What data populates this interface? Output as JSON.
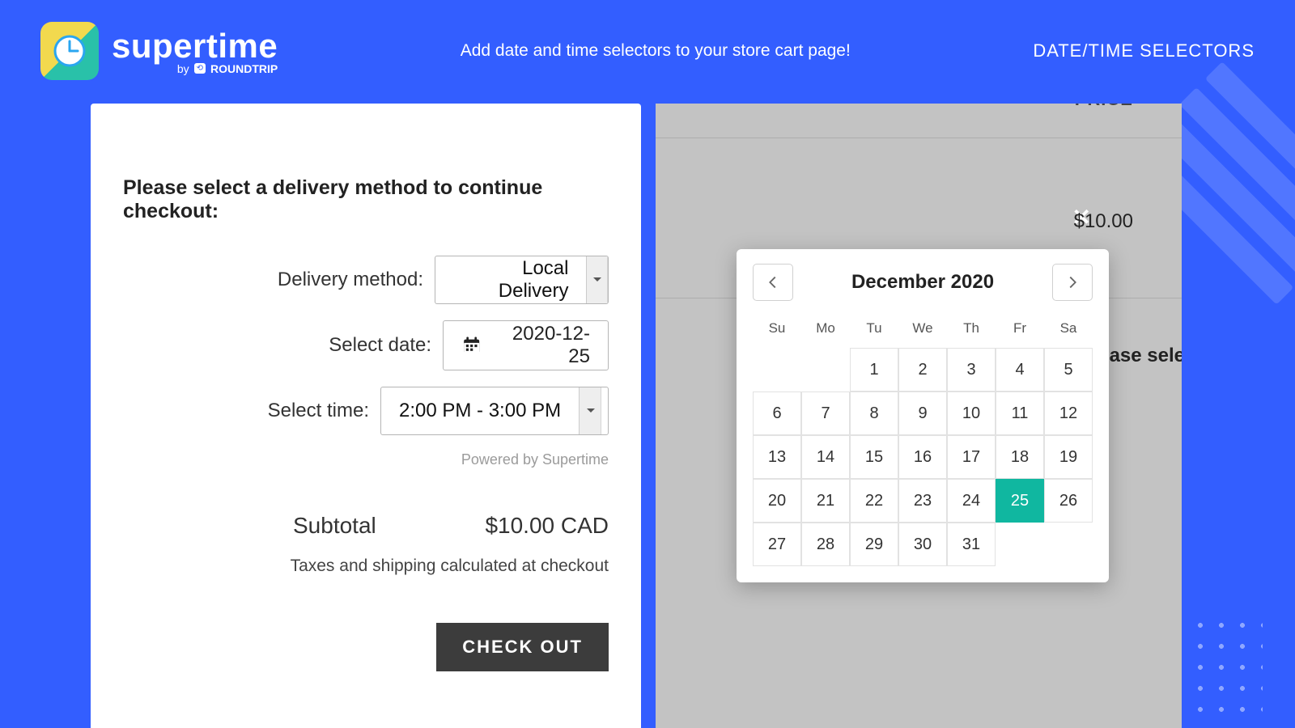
{
  "header": {
    "brand": "supertime",
    "byline_prefix": "by",
    "byline_brand": "ROUNDTRIP",
    "tagline": "Add date and time selectors to your store cart page!",
    "nav": "DATE/TIME SELECTORS"
  },
  "left": {
    "heading": "Please select a delivery method to continue checkout:",
    "method_label": "Delivery method:",
    "method_value": "Local Delivery",
    "date_label": "Select date:",
    "date_value": "2020-12-25",
    "time_label": "Select time:",
    "time_value": "2:00 PM - 3:00 PM",
    "powered": "Powered by Supertime",
    "subtotal_label": "Subtotal",
    "subtotal_value": "$10.00 CAD",
    "tax_note": "Taxes and shipping calculated at checkout",
    "checkout": "CHECK OUT"
  },
  "right": {
    "price_header": "PRICE",
    "price_value": "$10.00",
    "close": "✕",
    "please": "Please sele"
  },
  "calendar": {
    "title": "December 2020",
    "dow": [
      "Su",
      "Mo",
      "Tu",
      "We",
      "Th",
      "Fr",
      "Sa"
    ],
    "leading_blanks": 2,
    "days_in_month": 31,
    "selected_day": 25
  }
}
